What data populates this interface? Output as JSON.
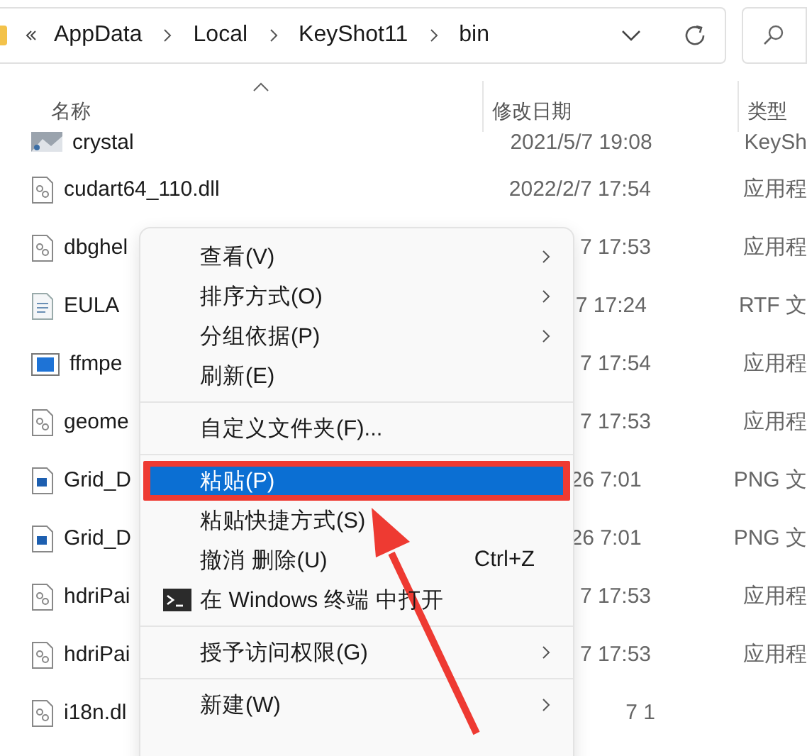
{
  "address_bar": {
    "crumbs": [
      "AppData",
      "Local",
      "KeyShot11",
      "bin"
    ]
  },
  "columns": [
    {
      "label": "名称",
      "sorted": true
    },
    {
      "label": "修改日期",
      "sorted": false
    },
    {
      "label": "类型",
      "sorted": false
    }
  ],
  "rows": [
    {
      "name": "crystal",
      "date": "2021/5/7 19:08",
      "type": "KeySh",
      "kind": "image"
    },
    {
      "name": "cudart64_110.dll",
      "date": "2022/2/7 17:54",
      "type": "应用程",
      "kind": "dll"
    },
    {
      "name": "dbghel",
      "date": "7 17:53",
      "type": "应用程",
      "kind": "dll"
    },
    {
      "name": "EULA",
      "date": "7 17:24",
      "type": "RTF 文",
      "kind": "doc"
    },
    {
      "name": "ffmpe",
      "date": "7 17:54",
      "type": "应用程",
      "kind": "app"
    },
    {
      "name": "geome",
      "date": "7 17:53",
      "type": "应用程",
      "kind": "dll"
    },
    {
      "name": "Grid_D",
      "date": "26 7:01",
      "type": "PNG 文",
      "kind": "png"
    },
    {
      "name": "Grid_D",
      "date": "26 7:01",
      "type": "PNG 文",
      "kind": "png"
    },
    {
      "name": "hdriPai",
      "date": "7 17:53",
      "type": "应用程",
      "kind": "dll"
    },
    {
      "name": "hdriPai",
      "date": "7 17:53",
      "type": "应用程",
      "kind": "dll"
    },
    {
      "name": "i18n.dl",
      "date": "7 1",
      "kind": "dll"
    }
  ],
  "context_menu": {
    "groups": [
      [
        {
          "label": "查看(V)",
          "submenu": true,
          "selected": false
        },
        {
          "label": "排序方式(O)",
          "submenu": true,
          "selected": false
        },
        {
          "label": "分组依据(P)",
          "submenu": true,
          "selected": false
        },
        {
          "label": "刷新(E)",
          "submenu": false,
          "selected": false
        }
      ],
      [
        {
          "label": "自定义文件夹(F)...",
          "submenu": false,
          "selected": false
        }
      ],
      [
        {
          "label": "粘贴(P)",
          "submenu": false,
          "selected": true
        },
        {
          "label": "粘贴快捷方式(S)",
          "submenu": false,
          "selected": false
        },
        {
          "label": "撤消 删除(U)",
          "shortcut": "Ctrl+Z",
          "submenu": false,
          "selected": false
        },
        {
          "label": "在 Windows 终端 中打开",
          "icon": true,
          "submenu": false,
          "selected": false
        }
      ],
      [
        {
          "label": "授予访问权限(G)",
          "submenu": true,
          "selected": false
        }
      ],
      [
        {
          "label": "新建(W)",
          "submenu": true,
          "selected": false
        }
      ]
    ]
  }
}
